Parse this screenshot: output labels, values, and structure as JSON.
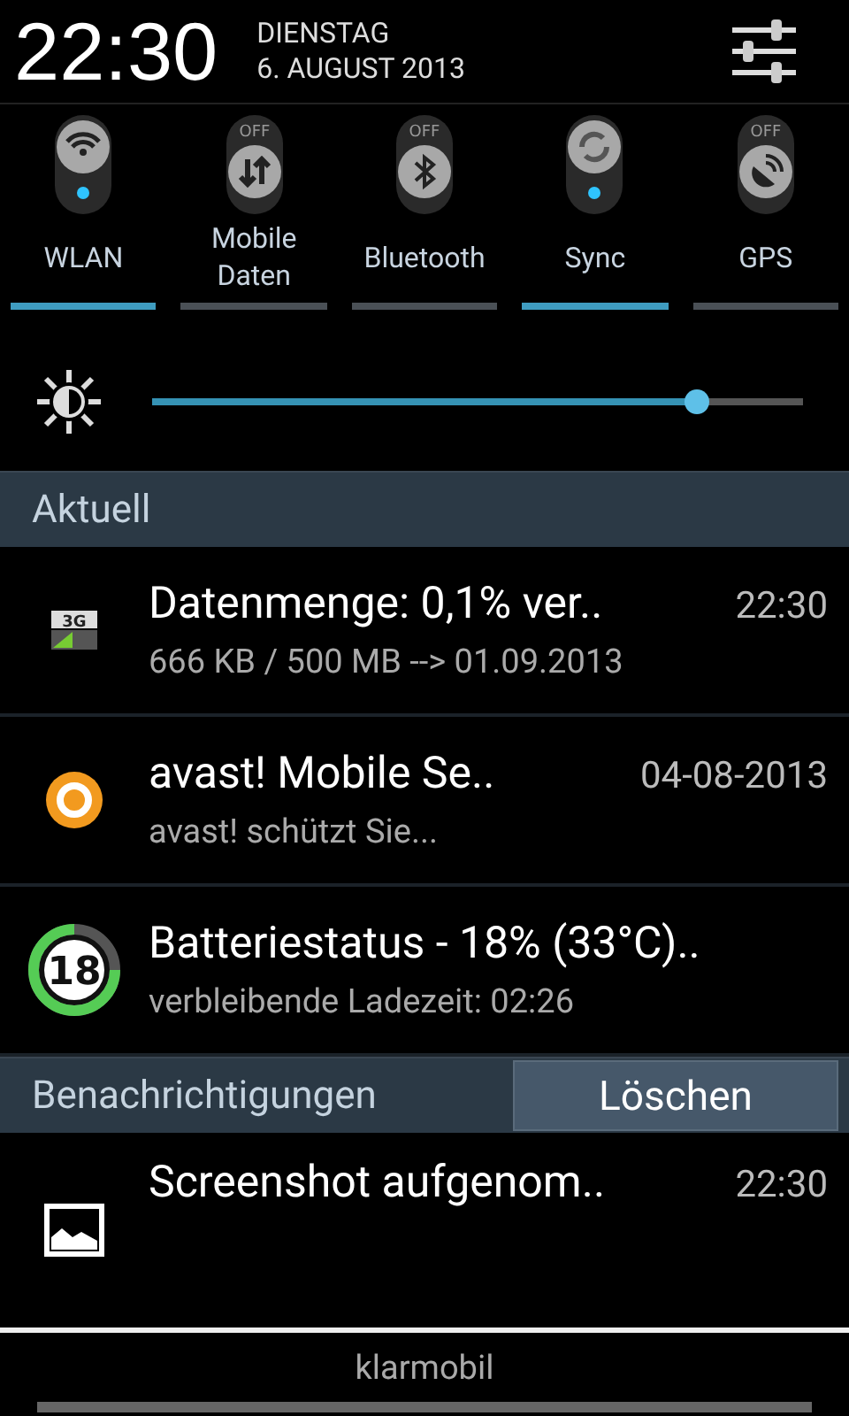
{
  "header": {
    "time": "22:30",
    "weekday": "DIENSTAG",
    "date": "6. AUGUST 2013"
  },
  "toggles": [
    {
      "kind": "wifi",
      "label": "WLAN",
      "on": true
    },
    {
      "kind": "data",
      "label": "Mobile Daten",
      "on": false,
      "state_text": "OFF"
    },
    {
      "kind": "bluetooth",
      "label": "Bluetooth",
      "on": false,
      "state_text": "OFF"
    },
    {
      "kind": "sync",
      "label": "Sync",
      "on": true
    },
    {
      "kind": "gps",
      "label": "GPS",
      "on": false,
      "state_text": "OFF"
    }
  ],
  "brightness": {
    "level": 0.836
  },
  "sections": [
    {
      "title": "Aktuell",
      "notifications": [
        {
          "kind": "data-usage",
          "badge": "3G",
          "title": "Datenmenge: 0,1% ver..",
          "time": "22:30",
          "text": "666 KB / 500 MB --> 01.09.2013"
        },
        {
          "kind": "antivirus",
          "title": "avast! Mobile Se..",
          "time": "04-08-2013",
          "text": "avast! schützt Sie..."
        },
        {
          "kind": "battery",
          "badge": "18",
          "title": "Batteriestatus - 18% (33°C)..",
          "text": "verbleibende Ladezeit: 02:26"
        }
      ]
    },
    {
      "title": "Benachrichtigungen",
      "action": "Löschen",
      "notifications": [
        {
          "kind": "image",
          "title": "Screenshot aufgenom..",
          "time": "22:30"
        }
      ]
    }
  ],
  "carrier": "klarmobil"
}
